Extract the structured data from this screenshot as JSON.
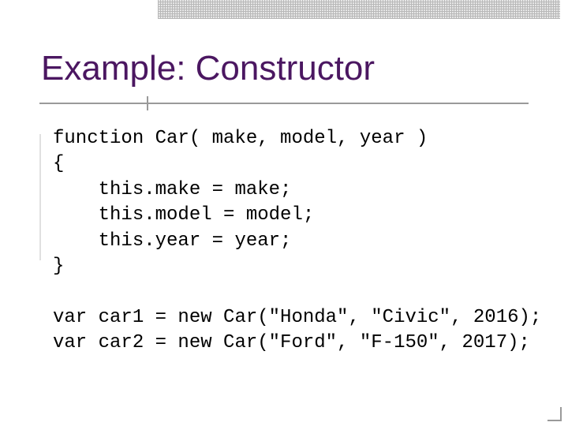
{
  "title": "Example: Constructor",
  "code": {
    "l1": "function Car( make, model, year )",
    "l2": "{",
    "l3": "    this.make = make;",
    "l4": "    this.model = model;",
    "l5": "    this.year = year;",
    "l6": "}",
    "l7": "",
    "l8": "var car1 = new Car(\"Honda\", \"Civic\", 2016);",
    "l9": "var car2 = new Car(\"Ford\", \"F-150\", 2017);"
  }
}
